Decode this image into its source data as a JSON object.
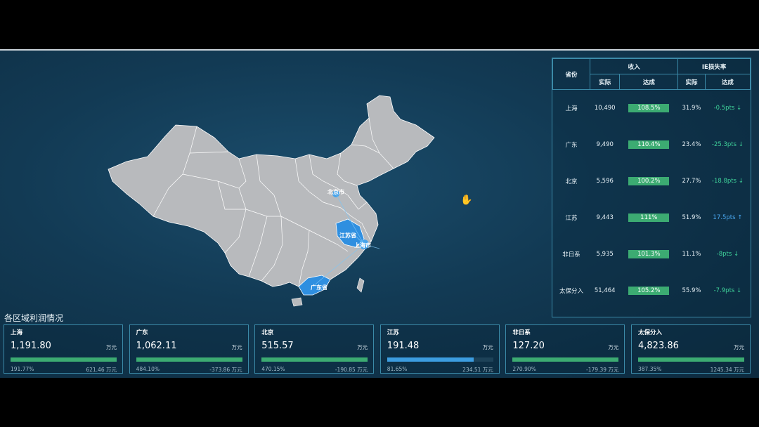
{
  "map": {
    "labels": {
      "beijing": "北京市",
      "jiangsu": "江苏省",
      "shanghai": "上海市",
      "guangdong": "广东省"
    }
  },
  "table": {
    "headers": {
      "province": "省份",
      "revenue": "收入",
      "ie_loss": "IE损失率",
      "actual": "实际",
      "achieved": "达成"
    },
    "rows": [
      {
        "province": "上海",
        "revenue_actual": "10,490",
        "revenue_achieved": "108.5%",
        "ie_actual": "31.9%",
        "ie_achieved": "-0.5pts ↓",
        "direction": "down"
      },
      {
        "province": "广东",
        "revenue_actual": "9,490",
        "revenue_achieved": "110.4%",
        "ie_actual": "23.4%",
        "ie_achieved": "-25.3pts ↓",
        "direction": "down"
      },
      {
        "province": "北京",
        "revenue_actual": "5,596",
        "revenue_achieved": "100.2%",
        "ie_actual": "27.7%",
        "ie_achieved": "-18.8pts ↓",
        "direction": "down"
      },
      {
        "province": "江苏",
        "revenue_actual": "9,443",
        "revenue_achieved": "111%",
        "ie_actual": "51.9%",
        "ie_achieved": "17.5pts ↑",
        "direction": "up"
      },
      {
        "province": "非日系",
        "revenue_actual": "5,935",
        "revenue_achieved": "101.3%",
        "ie_actual": "11.1%",
        "ie_achieved": "-8pts ↓",
        "direction": "down"
      },
      {
        "province": "太保分入",
        "revenue_actual": "51,464",
        "revenue_achieved": "105.2%",
        "ie_actual": "55.9%",
        "ie_achieved": "-7.9pts ↓",
        "direction": "down"
      }
    ]
  },
  "profit": {
    "title": "各区域利润情况",
    "unit": "万元",
    "cards": [
      {
        "name": "上海",
        "value": "1,191.80",
        "pct": "191.77%",
        "delta": "621.46",
        "progress": 1.0,
        "color": "#3cab72"
      },
      {
        "name": "广东",
        "value": "1,062.11",
        "pct": "484.10%",
        "delta": "-373.86",
        "progress": 1.0,
        "color": "#3cab72"
      },
      {
        "name": "北京",
        "value": "515.57",
        "pct": "470.15%",
        "delta": "-190.85",
        "progress": 1.0,
        "color": "#3cab72"
      },
      {
        "name": "江苏",
        "value": "191.48",
        "pct": "81.65%",
        "delta": "234.51",
        "progress": 0.8165,
        "color": "#3c9de0"
      },
      {
        "name": "非日系",
        "value": "127.20",
        "pct": "270.90%",
        "delta": "-179.39",
        "progress": 1.0,
        "color": "#3cab72"
      },
      {
        "name": "太保分入",
        "value": "4,823.86",
        "pct": "387.35%",
        "delta": "1245.34",
        "progress": 1.0,
        "color": "#3cab72"
      }
    ]
  },
  "colors": {
    "accent_green": "#3cab72",
    "accent_blue": "#3c9de0",
    "border": "#3b8aa8"
  }
}
